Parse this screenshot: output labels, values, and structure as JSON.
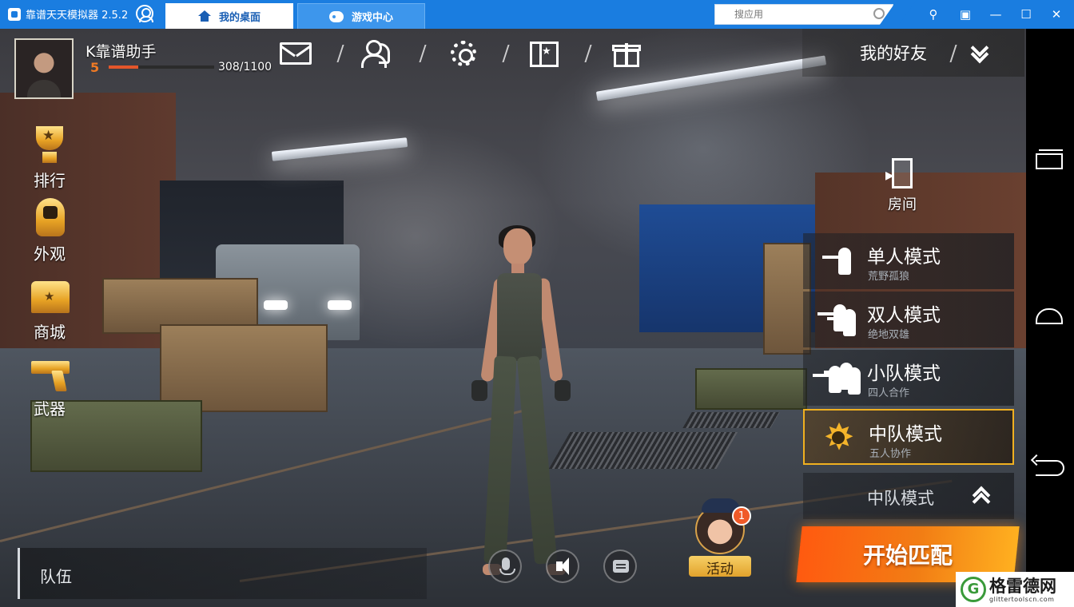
{
  "emulator": {
    "app_name": "靠谱天天模拟器 2.5.2",
    "tabs": [
      {
        "label": "我的桌面",
        "icon": "home-icon"
      },
      {
        "label": "游戏中心",
        "icon": "gamepad-icon"
      }
    ],
    "search": {
      "placeholder": "搜应用"
    },
    "window_controls": {
      "pin": "⚲",
      "restore": "▣",
      "minimize": "—",
      "maximize": "☐",
      "close": "✕"
    }
  },
  "player": {
    "name": "K靠谱助手",
    "level": "5",
    "xp_text": "308/1100",
    "xp_current": 308,
    "xp_max": 1100
  },
  "top_icons": [
    "mail-icon",
    "friends-icon",
    "settings-icon",
    "map-icon",
    "gift-icon"
  ],
  "friends_panel": {
    "label": "我的好友"
  },
  "left_menu": [
    {
      "label": "排行",
      "icon": "trophy-icon"
    },
    {
      "label": "外观",
      "icon": "outfit-icon"
    },
    {
      "label": "商城",
      "icon": "shop-chest-icon"
    },
    {
      "label": "武器",
      "icon": "pistol-icon"
    }
  ],
  "room": {
    "label": "房间"
  },
  "modes": [
    {
      "title": "单人模式",
      "subtitle": "荒野孤狼",
      "icon": "solo-soldier-icon",
      "selected": false
    },
    {
      "title": "双人模式",
      "subtitle": "绝地双雄",
      "icon": "duo-soldier-icon",
      "selected": false
    },
    {
      "title": "小队模式",
      "subtitle": "四人合作",
      "icon": "squad-soldier-icon",
      "selected": false
    },
    {
      "title": "中队模式",
      "subtitle": "五人协作",
      "icon": "star-badge-icon",
      "selected": true
    }
  ],
  "mode_dropdown": {
    "label": "中队模式"
  },
  "start_button": {
    "label": "开始匹配"
  },
  "activity": {
    "label": "活动",
    "badge_count": "1"
  },
  "team_bar": {
    "label": "队伍"
  },
  "watermark": {
    "name": "格雷德网",
    "url": "glittertoolscn.com",
    "logo_letter": "G"
  },
  "colors": {
    "titlebar": "#1a7de0",
    "accent_orange": "#f27d14",
    "level_orange": "#f07a24",
    "selected_border": "#f0b020"
  }
}
